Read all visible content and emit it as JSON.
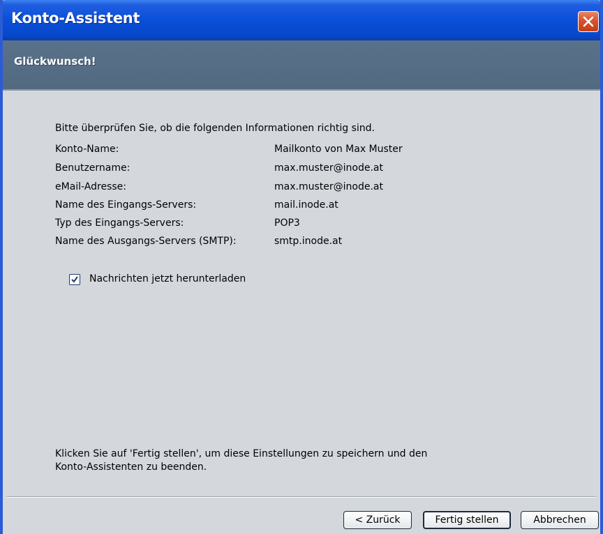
{
  "window": {
    "title": "Konto-Assistent"
  },
  "header": {
    "title": "Glückwunsch!"
  },
  "content": {
    "intro": "Bitte überprüfen Sie, ob die folgenden Informationen richtig sind.",
    "info": [
      {
        "label": "Konto-Name:",
        "value": "Mailkonto von Max Muster"
      },
      {
        "label": "Benutzername:",
        "value": "max.muster@inode.at"
      },
      {
        "label": "eMail-Adresse:",
        "value": "max.muster@inode.at"
      },
      {
        "label": "Name des Eingangs-Servers:",
        "value": "mail.inode.at"
      },
      {
        "label": "Typ des Eingangs-Servers:",
        "value": "POP3"
      },
      {
        "label": "Name des Ausgangs-Servers (SMTP):",
        "value": "smtp.inode.at"
      }
    ],
    "download_checkbox": {
      "label": "Nachrichten jetzt herunterladen",
      "checked": true
    },
    "outro_line1": "Klicken Sie auf 'Fertig stellen', um diese Einstellungen zu speichern und den",
    "outro_line2": "Konto-Assistenten zu beenden."
  },
  "buttons": {
    "back": "< Zurück",
    "finish": "Fertig stellen",
    "cancel": "Abbrechen"
  },
  "colors": {
    "titlebar": "#0a4fd8",
    "header": "#566e85",
    "dialog_background": "#d4d8dd",
    "close_button": "#d9522c"
  },
  "icons": {
    "close": "close-x-icon",
    "checkmark": "checkmark-icon"
  }
}
